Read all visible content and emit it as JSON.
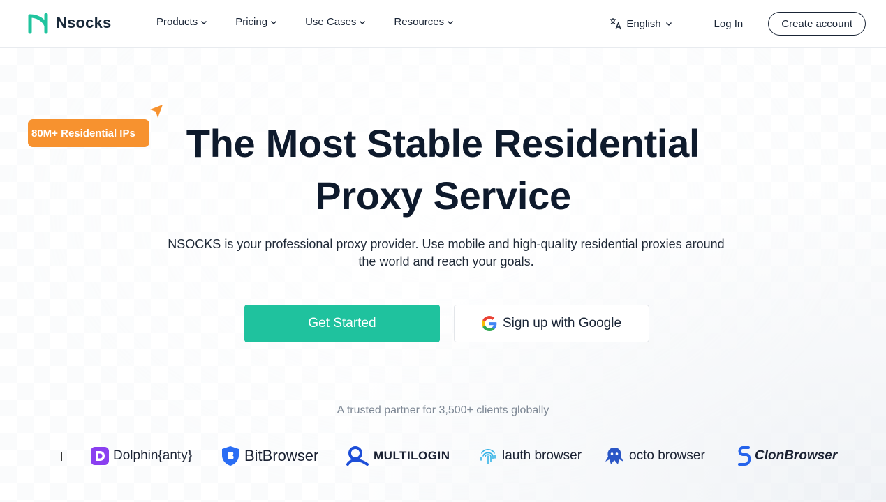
{
  "header": {
    "logo_text": "Nsocks",
    "nav": [
      {
        "label": "Products"
      },
      {
        "label": "Pricing"
      },
      {
        "label": "Use Cases"
      },
      {
        "label": "Resources"
      }
    ],
    "language": "English",
    "login": "Log In",
    "create_account": "Create account"
  },
  "hero": {
    "badge": "80M+ Residential IPs",
    "title_line1": "The Most Stable Residential",
    "title_line2": "Proxy Service",
    "subtitle_line1": "NSOCKS is your professional proxy provider. Use mobile and high-quality residential proxies around",
    "subtitle_line2": "the world and reach your goals.",
    "primary_button": "Get Started",
    "google_button": "Sign up with Google"
  },
  "partners": {
    "heading": "A trusted partner for 3,500+ clients globally",
    "logos": [
      {
        "name": "Dolphin{anty}",
        "icon": "dolphin-icon"
      },
      {
        "name": "BitBrowser",
        "icon": "bitbrowser-icon"
      },
      {
        "name": "MULTILOGIN",
        "icon": "multilogin-icon"
      },
      {
        "name": "lauth browser",
        "icon": "lauth-icon"
      },
      {
        "name": "octo browser",
        "icon": "octo-icon"
      },
      {
        "name": "ClonBrowser",
        "icon": "clonbrowser-icon"
      }
    ]
  },
  "colors": {
    "brand_green": "#1fc29e",
    "badge_orange": "#f7922f",
    "text_dark": "#0e1a2c"
  }
}
